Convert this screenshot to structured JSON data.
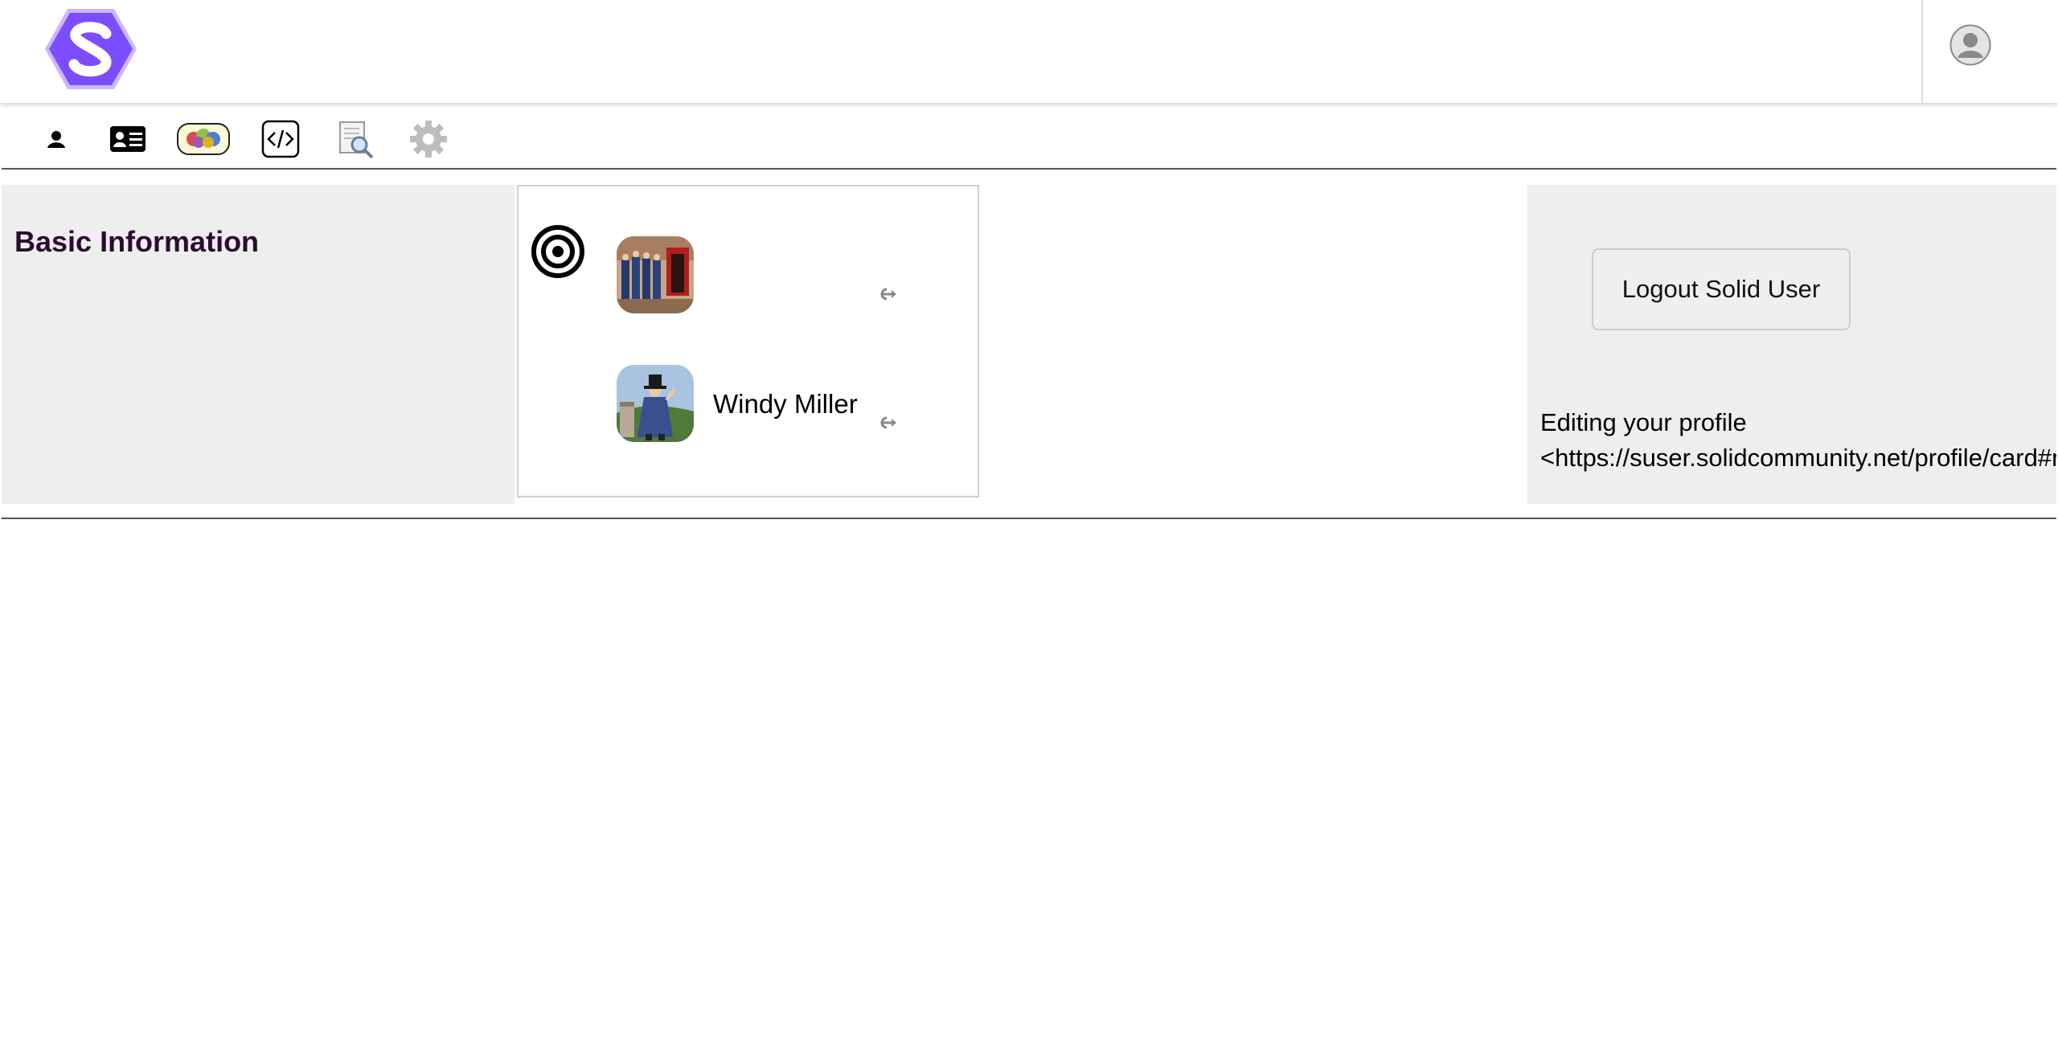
{
  "header": {
    "logo_letter": "S",
    "brand_color": "#7c4dff",
    "avatar_icon": "user-avatar-icon"
  },
  "toolbar": {
    "items": [
      {
        "icon": "person-icon"
      },
      {
        "icon": "id-card-icon"
      },
      {
        "icon": "group-faces-icon"
      },
      {
        "icon": "code-icon"
      },
      {
        "icon": "document-search-icon"
      },
      {
        "icon": "gear-icon"
      }
    ]
  },
  "basic_info": {
    "title": "Basic Information"
  },
  "people": {
    "target_icon": "bullseye-icon",
    "items": [
      {
        "name": "",
        "photo": "group-photo",
        "link_icon": "open-link-icon"
      },
      {
        "name": "Windy Miller",
        "photo": "windy-miller-photo",
        "link_icon": "open-link-icon"
      }
    ]
  },
  "profile": {
    "logout_label": "Logout Solid User",
    "editing_label": "Editing your profile",
    "profile_uri": "<https://suser.solidcommunity.net/profile/card#me>"
  },
  "colors": {
    "panel_bg": "#eeeeee",
    "title_color": "#2a0d2e",
    "logo_purple": "#7c4dff"
  }
}
